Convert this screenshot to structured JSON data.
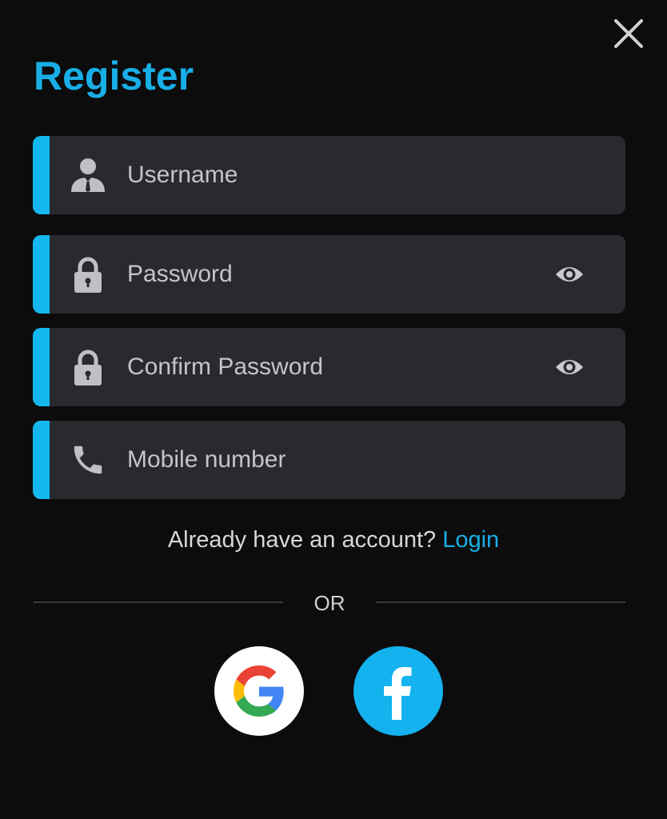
{
  "dialog": {
    "title": "Register",
    "close_icon": "close-icon"
  },
  "fields": {
    "username": {
      "placeholder": "Username",
      "value": "",
      "icon": "user-icon"
    },
    "password": {
      "placeholder": "Password",
      "value": "",
      "icon": "lock-icon",
      "toggle_icon": "eye-icon"
    },
    "confirm_password": {
      "placeholder": "Confirm Password",
      "value": "",
      "icon": "lock-icon",
      "toggle_icon": "eye-icon"
    },
    "mobile": {
      "placeholder": "Mobile number",
      "value": "",
      "icon": "phone-icon"
    }
  },
  "login_prompt": {
    "text": "Already have an account?",
    "link_label": "Login"
  },
  "separator": {
    "label": "OR"
  },
  "social": {
    "google_icon": "google-icon",
    "facebook_icon": "facebook-icon",
    "facebook_color": "#14b2ee"
  },
  "colors": {
    "background": "#0c0c0d",
    "field_background": "#29292f",
    "accent": "#15b8ee",
    "title": "#19aee6",
    "link": "#1aaee4"
  }
}
